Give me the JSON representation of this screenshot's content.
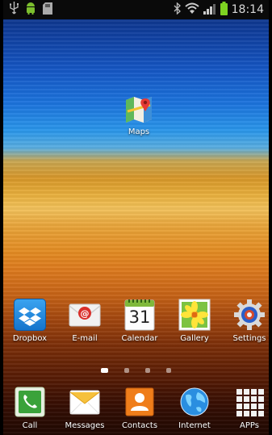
{
  "status_bar": {
    "time": "18:14",
    "icons": [
      "usb-icon",
      "android-debug-icon",
      "sd-card-icon",
      "bluetooth-icon",
      "wifi-icon",
      "signal-icon",
      "battery-icon"
    ]
  },
  "widgets": {
    "maps": {
      "label": "Maps",
      "icon": "maps-icon"
    }
  },
  "home_apps": [
    {
      "label": "Dropbox",
      "icon": "dropbox-icon"
    },
    {
      "label": "E-mail",
      "icon": "email-icon"
    },
    {
      "label": "Calendar",
      "icon": "calendar-icon",
      "day": "31"
    },
    {
      "label": "Gallery",
      "icon": "gallery-icon"
    },
    {
      "label": "Settings",
      "icon": "settings-icon"
    }
  ],
  "page_indicator": {
    "pages": 4,
    "active": 0
  },
  "dock": [
    {
      "label": "Call",
      "icon": "phone-icon"
    },
    {
      "label": "Messages",
      "icon": "messages-icon"
    },
    {
      "label": "Contacts",
      "icon": "contacts-icon"
    },
    {
      "label": "Internet",
      "icon": "globe-icon"
    },
    {
      "label": "APPs",
      "icon": "apps-grid-icon"
    }
  ],
  "colors": {
    "status_bar_bg": "#0a0a0a",
    "battery": "#7ed321",
    "android_green": "#7cbf2e",
    "dropbox_blue": "#1f8ce6",
    "contacts_orange": "#ef7d1a",
    "call_green": "#3aa23a"
  }
}
